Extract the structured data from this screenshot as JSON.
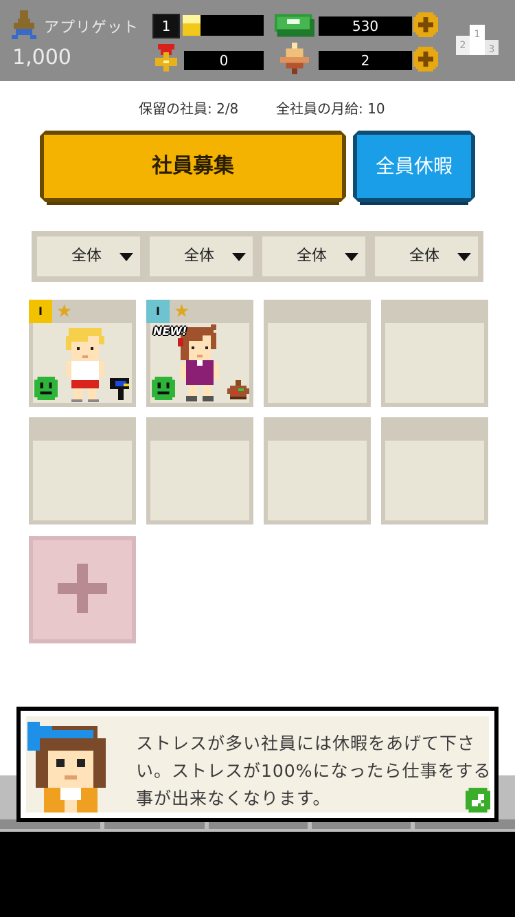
{
  "header": {
    "company_name": "アプリゲット",
    "money": "1,000",
    "level": "1",
    "level_progress": 0.22,
    "cash": "530",
    "medals": "0",
    "gems": "2"
  },
  "info": {
    "pending_staff": "保留の社員: 2/8",
    "monthly_salary": "全社員の月給: 10"
  },
  "buttons": {
    "recruit": "社員募集",
    "vacation": "全員休暇"
  },
  "filters": [
    "全体",
    "全体",
    "全体",
    "全体"
  ],
  "employees": [
    {
      "level_tag": "I",
      "star": "★",
      "tag_color": "#f2c200"
    },
    {
      "level_tag": "I",
      "star": "★",
      "tag_color": "#6ec3d0",
      "new_label": "NEW!"
    }
  ],
  "dialog": {
    "message": "ストレスが多い社員には休暇をあげて下さい。ストレスが100%になったら仕事をする事が出来なくなります。"
  },
  "icons": [
    "person-icon",
    "cash-icon",
    "coin-icon",
    "medal-icon",
    "gem-icon",
    "ranking-icon",
    "dropdown-icon",
    "plus-icon",
    "next-icon"
  ]
}
